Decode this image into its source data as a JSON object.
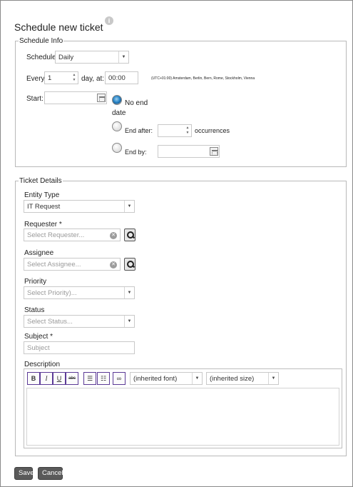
{
  "page": {
    "title": "Schedule new ticket",
    "help_icon": "info-icon"
  },
  "schedule_info": {
    "legend": "Schedule Info",
    "schedule_label": "Schedule:",
    "schedule_value": "Daily",
    "every_label": "Every:",
    "every_value": "1",
    "day_at_label": "day, at:",
    "time_value": "00:00",
    "timezone": "(UTC+01:00) Amsterdam, Berlin, Bern, Rome, Stockholm, Vienna",
    "start_label": "Start:",
    "start_value": "",
    "end_options": {
      "no_end_line1": "No end",
      "no_end_line2": "date",
      "end_after": "End after:",
      "occurrences": "occurrences",
      "end_by": "End by:"
    },
    "selected_end_option": "no_end_date"
  },
  "ticket_details": {
    "legend": "Ticket Details",
    "entity_type_label": "Entity Type",
    "entity_type_value": "IT Request",
    "requester_label": "Requester *",
    "requester_placeholder": "Select Requester...",
    "assignee_label": "Assignee",
    "assignee_placeholder": "Select Assignee...",
    "priority_label": "Priority",
    "priority_placeholder": "Select Priority)...",
    "status_label": "Status",
    "status_placeholder": "Select Status...",
    "subject_label": "Subject *",
    "subject_placeholder": "Subject",
    "description_label": "Description",
    "toolbar": {
      "bold": "B",
      "italic": "I",
      "underline": "U",
      "strike": "abc",
      "font": "(inherited font)",
      "size": "(inherited size)"
    }
  },
  "actions": {
    "save": "Save",
    "cancel": "Cancel"
  },
  "colors": {
    "toolbar_border": "#5b3a96",
    "button_bg": "#5a5a5a",
    "radio_selected": "#2a86c8"
  }
}
